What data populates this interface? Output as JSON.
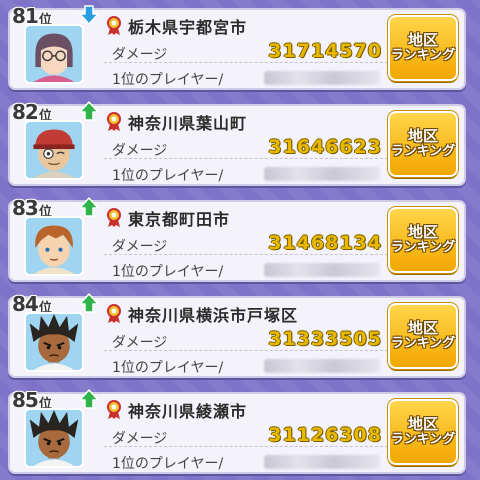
{
  "entries": [
    {
      "rank": "81",
      "rank_suffix": "位",
      "trend": "down",
      "prefecture": "栃木県宇都宮市",
      "damage_label": "ダメージ",
      "damage": "31714570",
      "player_label": "1位のプレイヤー/",
      "button_line1": "地区",
      "button_line2": "ランキング",
      "avatar": "girl-with-glasses-avatar",
      "avatar_colors": {
        "hair": "#6b4f63",
        "skin": "#f7d7bf",
        "shirt": "#d85e8e"
      }
    },
    {
      "rank": "82",
      "rank_suffix": "位",
      "trend": "up",
      "prefecture": "神奈川県葉山町",
      "damage_label": "ダメージ",
      "damage": "31646623",
      "player_label": "1位のプレイヤー/",
      "button_line1": "地区",
      "button_line2": "ランキング",
      "avatar": "old-man-with-red-cap-avatar",
      "avatar_colors": {
        "hair": "#c23b35",
        "skin": "#e9c69c",
        "shirt": "#d9d1be"
      }
    },
    {
      "rank": "83",
      "rank_suffix": "位",
      "trend": "up",
      "prefecture": "東京都町田市",
      "damage_label": "ダメージ",
      "damage": "31468134",
      "player_label": "1位のプレイヤー/",
      "button_line1": "地区",
      "button_line2": "ランキング",
      "avatar": "brown-hair-boy-avatar",
      "avatar_colors": {
        "hair": "#b8642a",
        "skin": "#f6d4b0",
        "shirt": "#f0e2c7"
      }
    },
    {
      "rank": "84",
      "rank_suffix": "位",
      "trend": "up",
      "prefecture": "神奈川県横浜市戸塚区",
      "damage_label": "ダメージ",
      "damage": "31333505",
      "player_label": "1位のプレイヤー/",
      "button_line1": "地区",
      "button_line2": "ランキング",
      "avatar": "spiky-hair-boy-avatar",
      "avatar_colors": {
        "hair": "#2a2421",
        "skin": "#a86a3d",
        "shirt": "#f2f2f2"
      }
    },
    {
      "rank": "85",
      "rank_suffix": "位",
      "trend": "up",
      "prefecture": "神奈川県綾瀬市",
      "damage_label": "ダメージ",
      "damage": "31126308",
      "player_label": "1位のプレイヤー/",
      "button_line1": "地区",
      "button_line2": "ランキング",
      "avatar": "spiky-hair-boy-avatar",
      "avatar_colors": {
        "hair": "#2a2421",
        "skin": "#a86a3d",
        "shirt": "#f2f2f2"
      }
    }
  ],
  "colors": {
    "background": "#7f73c9",
    "card": "#f4f3fb",
    "damage_text": "#e7b800",
    "button": "#f6b81a",
    "up_arrow": "#2fb54a",
    "down_arrow": "#2a9ee0",
    "medal": "#d93030"
  }
}
